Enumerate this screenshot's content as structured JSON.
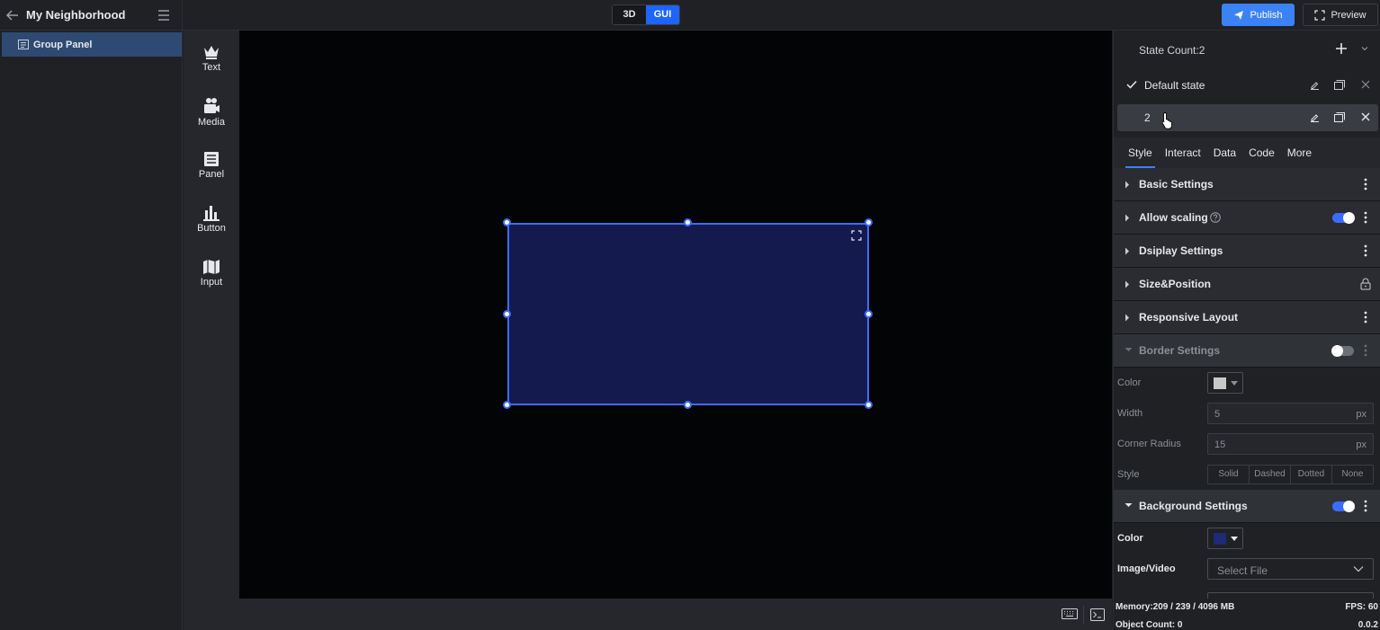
{
  "app": {
    "project_title": "My Neighborhood",
    "mode_3d": "3D",
    "mode_gui": "GUI",
    "publish": "Publish",
    "preview": "Preview"
  },
  "layers": {
    "items": [
      {
        "label": "Group Panel",
        "icon": "panel-icon",
        "selected": true
      }
    ]
  },
  "components": [
    {
      "label": "Text",
      "icon": "text-icon"
    },
    {
      "label": "Media",
      "icon": "media-icon"
    },
    {
      "label": "Panel",
      "icon": "panel-icon"
    },
    {
      "label": "Button",
      "icon": "button-icon"
    },
    {
      "label": "Input",
      "icon": "input-icon"
    }
  ],
  "canvas": {
    "widget_color": "#141a4e",
    "selection_color": "#3b6cff"
  },
  "inspector": {
    "state_count": "State Count:2",
    "states": [
      {
        "name": "Default state",
        "checked": true
      },
      {
        "name": "2",
        "checked": false,
        "selected": true
      }
    ],
    "tabs": [
      "Style",
      "Interact",
      "Data",
      "Code",
      "More"
    ],
    "active_tab": "Style",
    "sections": {
      "basic": "Basic Settings",
      "allow_scaling": "Allow scaling",
      "display": "Dsiplay Settings",
      "size_position": "Size&Position",
      "responsive": "Responsive Layout",
      "border": "Border Settings",
      "background": "Background Settings"
    },
    "border": {
      "color_label": "Color",
      "color_value": "#c8c8c8",
      "width_label": "Width",
      "width_value": "5",
      "width_unit": "px",
      "radius_label": "Corner Radius",
      "radius_value": "15",
      "radius_unit": "px",
      "style_label": "Style",
      "style_options": [
        "Solid",
        "Dashed",
        "Dotted",
        "None"
      ]
    },
    "background": {
      "color_label": "Color",
      "color_value": "#141a4e",
      "media_label": "Image/Video",
      "media_placeholder": "Select File"
    }
  },
  "status": {
    "memory": "Memory:209 / 239 / 4096 MB",
    "fps": "FPS: 60",
    "object_count": "Object Count: 0",
    "value": "0.0.2"
  }
}
